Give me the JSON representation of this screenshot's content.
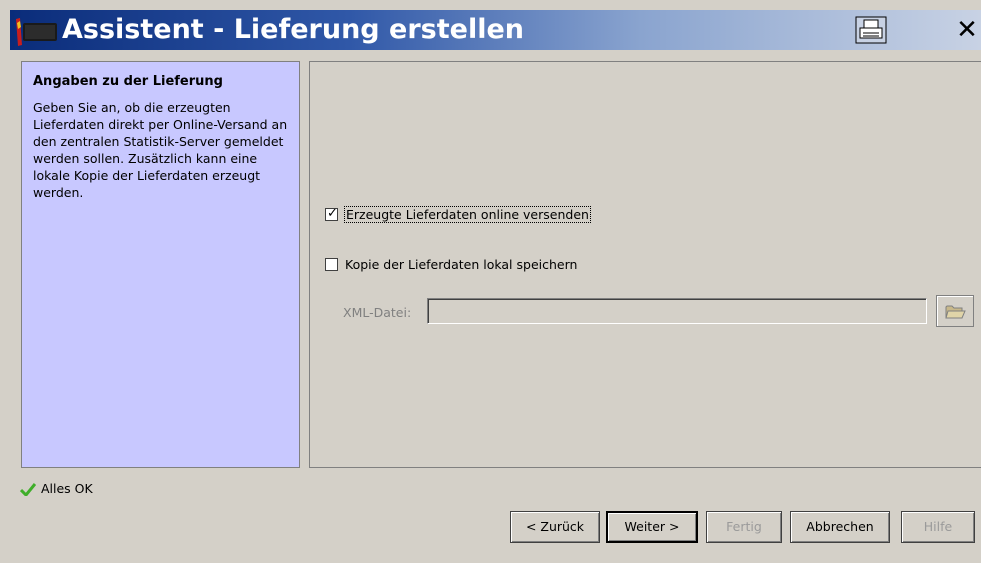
{
  "window": {
    "title": "Assistent - Lieferung erstellen",
    "close_glyph": "✕",
    "icons": [
      "app-icon",
      "print-icon",
      "close-icon"
    ]
  },
  "left_panel": {
    "heading": "Angaben zu der Lieferung",
    "description": "Geben Sie an, ob die erzeugten Lieferdaten direkt per Online-Versand an den zentralen Statistik-Server gemeldet werden sollen. Zusätzlich kann eine lokale Kopie der Lieferdaten erzeugt werden."
  },
  "options": {
    "online": {
      "label": "Erzeugte Lieferdaten online versenden",
      "checked": true
    },
    "local": {
      "label": "Kopie der Lieferdaten lokal speichern",
      "checked": false
    }
  },
  "xml": {
    "label": "XML-Datei:",
    "value": ""
  },
  "status": {
    "text": "Alles OK"
  },
  "buttons": {
    "back": "< Zurück",
    "next": "Weiter >",
    "finish": "Fertig",
    "cancel": "Abbrechen",
    "help": "Hilfe"
  },
  "colors": {
    "title_gradient_start": "#0a2c7a",
    "title_gradient_end": "#c8d2e4",
    "info_panel": "#c8c8ff",
    "dialog_bg": "#d4d0c8",
    "status_ok": "#3fae2a"
  }
}
